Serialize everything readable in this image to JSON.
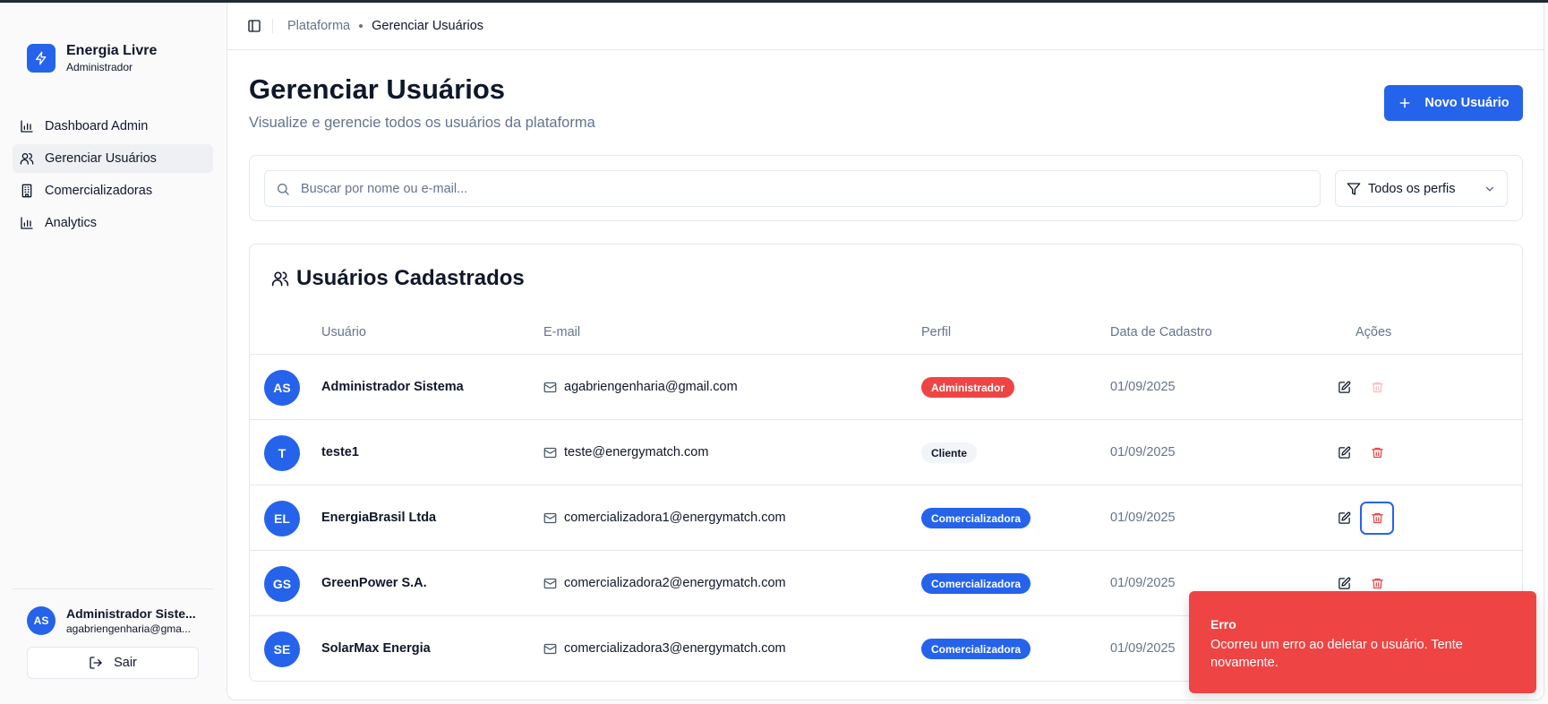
{
  "app": {
    "name": "Energia Livre",
    "role": "Administrador"
  },
  "sidebar": {
    "items": [
      {
        "label": "Dashboard Admin",
        "icon": "bar-chart-icon",
        "active": false
      },
      {
        "label": "Gerenciar Usuários",
        "icon": "users-icon",
        "active": true
      },
      {
        "label": "Comercializadoras",
        "icon": "building-icon",
        "active": false
      },
      {
        "label": "Analytics",
        "icon": "bar-chart-icon",
        "active": false
      }
    ],
    "user": {
      "initials": "AS",
      "name": "Administrador Siste...",
      "email": "agabriengenharia@gma..."
    },
    "logout_label": "Sair"
  },
  "breadcrumb": {
    "parent": "Plataforma",
    "current": "Gerenciar Usuários"
  },
  "page": {
    "title": "Gerenciar Usuários",
    "subtitle": "Visualize e gerencie todos os usuários da plataforma",
    "new_button": "Novo Usuário"
  },
  "filters": {
    "search_placeholder": "Buscar por nome ou e-mail...",
    "role_select": "Todos os perfis"
  },
  "table": {
    "title": "Usuários Cadastrados",
    "headers": {
      "user": "Usuário",
      "email": "E-mail",
      "role": "Perfil",
      "date": "Data de Cadastro",
      "actions": "Ações"
    },
    "rows": [
      {
        "initials": "AS",
        "name": "Administrador Sistema",
        "email": "agabriengenharia@gmail.com",
        "role": "Administrador",
        "date": "01/09/2025"
      },
      {
        "initials": "T",
        "name": "teste1",
        "email": "teste@energymatch.com",
        "role": "Cliente",
        "date": "01/09/2025"
      },
      {
        "initials": "EL",
        "name": "EnergiaBrasil Ltda",
        "email": "comercializadora1@energymatch.com",
        "role": "Comercializadora",
        "date": "01/09/2025"
      },
      {
        "initials": "GS",
        "name": "GreenPower S.A.",
        "email": "comercializadora2@energymatch.com",
        "role": "Comercializadora",
        "date": "01/09/2025"
      },
      {
        "initials": "SE",
        "name": "SolarMax Energia",
        "email": "comercializadora3@energymatch.com",
        "role": "Comercializadora",
        "date": "01/09/2025"
      }
    ]
  },
  "toast": {
    "title": "Erro",
    "message": "Ocorreu um erro ao deletar o usuário. Tente novamente."
  },
  "colors": {
    "primary": "#2563eb",
    "danger": "#ef4444",
    "muted": "#64748b"
  }
}
